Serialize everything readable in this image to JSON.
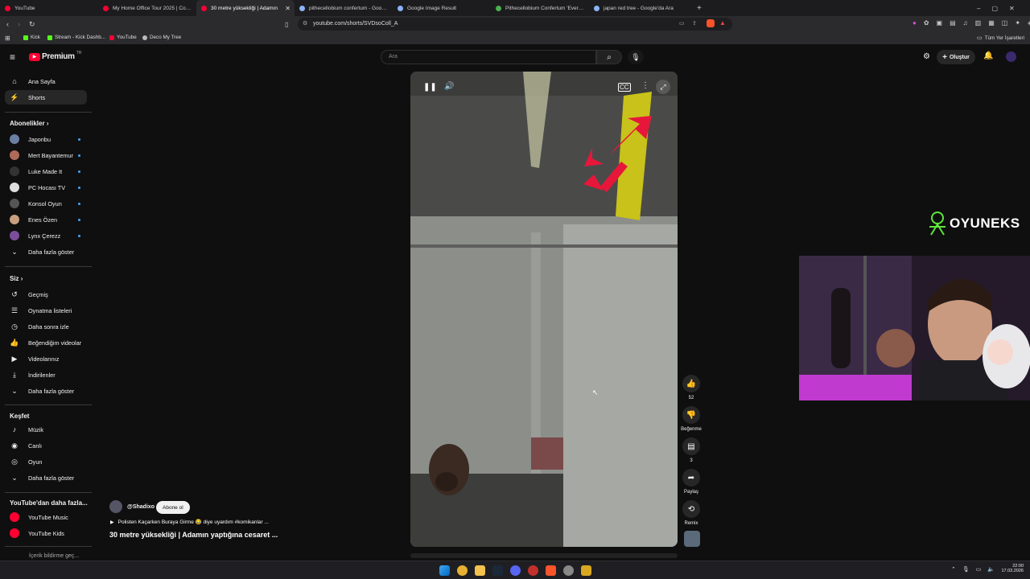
{
  "browser": {
    "tabs": [
      {
        "title": "YouTube",
        "color": "#ff0033",
        "active": false
      },
      {
        "title": "My Home Office Tour 2025 | Content",
        "color": "#ff0033",
        "active": false
      },
      {
        "title": "30 metre yüksekliği | Adamın",
        "color": "#ff0033",
        "active": true
      },
      {
        "title": "pithecellobium confertum - Google'd",
        "color": "#8ab4f8",
        "active": false
      },
      {
        "title": "Google Image Result",
        "color": "#8ab4f8",
        "active": false
      },
      {
        "title": "Pithecellobium Confertum 'Everfresh",
        "color": "#4caf50",
        "active": false
      },
      {
        "title": "japan red tree - Google'da Ara",
        "color": "#8ab4f8",
        "active": false
      }
    ],
    "url": "youtube.com/shorts/SVDsoColl_A",
    "bookmarks": [
      {
        "label": "Kick",
        "color": "#53fc18"
      },
      {
        "label": "Stream - Kick Dashb...",
        "color": "#53fc18"
      },
      {
        "label": "YouTube",
        "color": "#ff0033"
      },
      {
        "label": "Deco My Tree",
        "color": "#bbbbbb"
      }
    ],
    "all_bookmarks": "Tüm Yer İşaretleri"
  },
  "youtube": {
    "logo_text": "Premium",
    "logo_sup": "TR",
    "search_placeholder": "Ara",
    "create_label": "Oluştur",
    "sidebar": {
      "main": [
        {
          "label": "Ana Sayfa",
          "icon": "home-icon"
        },
        {
          "label": "Shorts",
          "icon": "shorts-icon",
          "active": true
        }
      ],
      "subs_title": "Abonelikler",
      "subs": [
        {
          "label": "Japonbu",
          "color": "#6b7fa3"
        },
        {
          "label": "Mert Bayantemur",
          "color": "#b06a5a"
        },
        {
          "label": "Luke Made It",
          "color": "#333"
        },
        {
          "label": "PC Hocası TV",
          "color": "#dddddd"
        },
        {
          "label": "Konsol Oyun",
          "color": "#555"
        },
        {
          "label": "Enes Özen",
          "color": "#c8a080"
        },
        {
          "label": "Lynx Çerezz",
          "color": "#7a4e9a"
        }
      ],
      "subs_more": "Daha fazla göster",
      "you_title": "Siz",
      "you": [
        {
          "label": "Geçmiş",
          "icon": "history-icon"
        },
        {
          "label": "Oynatma listeleri",
          "icon": "playlist-icon"
        },
        {
          "label": "Daha sonra izle",
          "icon": "clock-icon"
        },
        {
          "label": "Beğendiğim videolar",
          "icon": "like-icon"
        },
        {
          "label": "Videolarınız",
          "icon": "video-icon"
        },
        {
          "label": "İndirilenler",
          "icon": "download-icon"
        },
        {
          "label": "Daha fazla göster",
          "icon": "chevron-down-icon"
        }
      ],
      "explore_title": "Keşfet",
      "explore": [
        {
          "label": "Müzik",
          "icon": "music-icon"
        },
        {
          "label": "Canlı",
          "icon": "live-icon"
        },
        {
          "label": "Oyun",
          "icon": "gaming-icon"
        },
        {
          "label": "Daha fazla göster",
          "icon": "chevron-down-icon"
        }
      ],
      "more_title": "YouTube'dan daha fazla...",
      "more": [
        {
          "label": "YouTube Music",
          "color": "#ff0033"
        },
        {
          "label": "YouTube Kids",
          "color": "#ff0033"
        }
      ],
      "footer_cut": "İçerik bildirme geç..."
    },
    "short": {
      "channel": "@Shadixo",
      "subscribe": "Abone ol",
      "caption": "Polisten Kaçarken Buraya Girme 😂 diye uyardım  #komikanlar ...",
      "title": "30 metre yüksekliği | Adamın yaptığına cesaret ...",
      "likes": "52",
      "dislike_label": "Beğenme",
      "comments": "3",
      "share_label": "Paylaş",
      "remix_label": "Remix"
    }
  },
  "overlay": {
    "brand": "OYUNEKS"
  },
  "taskbar": {
    "time": "22:00",
    "date": "17.03.2026"
  }
}
